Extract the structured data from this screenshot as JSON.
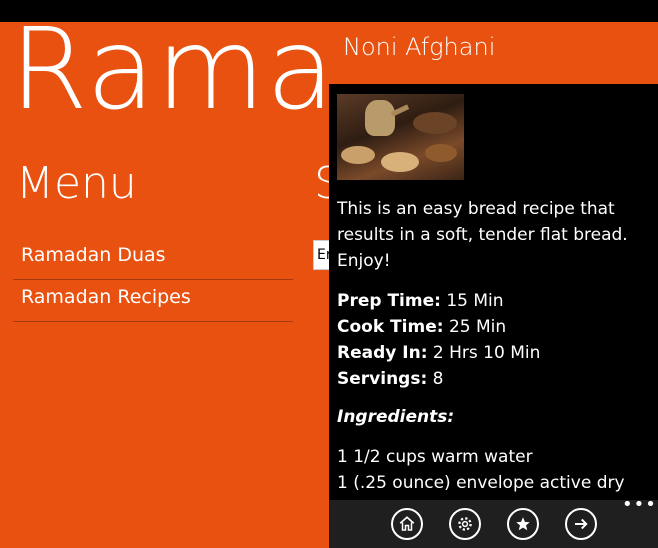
{
  "left_panel": {
    "app_title": "Ramadan",
    "menu_heading": "Menu",
    "next_section_heading": "S",
    "peek_input_value": "Er",
    "menu_items": [
      {
        "label": "Ramadan Duas"
      },
      {
        "label": "Ramadan Recipes"
      }
    ]
  },
  "recipe": {
    "title": "Noni Afghani",
    "photo_icon": "recipe-photo",
    "description": "This is an easy bread recipe that results in a soft, tender flat bread. Enjoy!",
    "facts": {
      "prep": {
        "label": "Prep Time:",
        "value": "15 Min"
      },
      "cook": {
        "label": "Cook Time:",
        "value": "25 Min"
      },
      "ready": {
        "label": "Ready In:",
        "value": "2 Hrs 10 Min"
      },
      "servings": {
        "label": "Servings:",
        "value": "8"
      }
    },
    "ingredients_heading": "Ingredients:",
    "ingredients": [
      "1 1/2 cups warm water",
      "1 (.25 ounce) envelope active dry"
    ]
  },
  "app_bar": {
    "buttons": [
      {
        "icon": "home-icon"
      },
      {
        "icon": "settings-icon"
      },
      {
        "icon": "star-icon"
      },
      {
        "icon": "arrow-right-icon"
      }
    ],
    "more_label": "•••"
  },
  "colors": {
    "accent": "#e8510f",
    "background": "#000000",
    "app_bar": "#1f1f1f"
  }
}
